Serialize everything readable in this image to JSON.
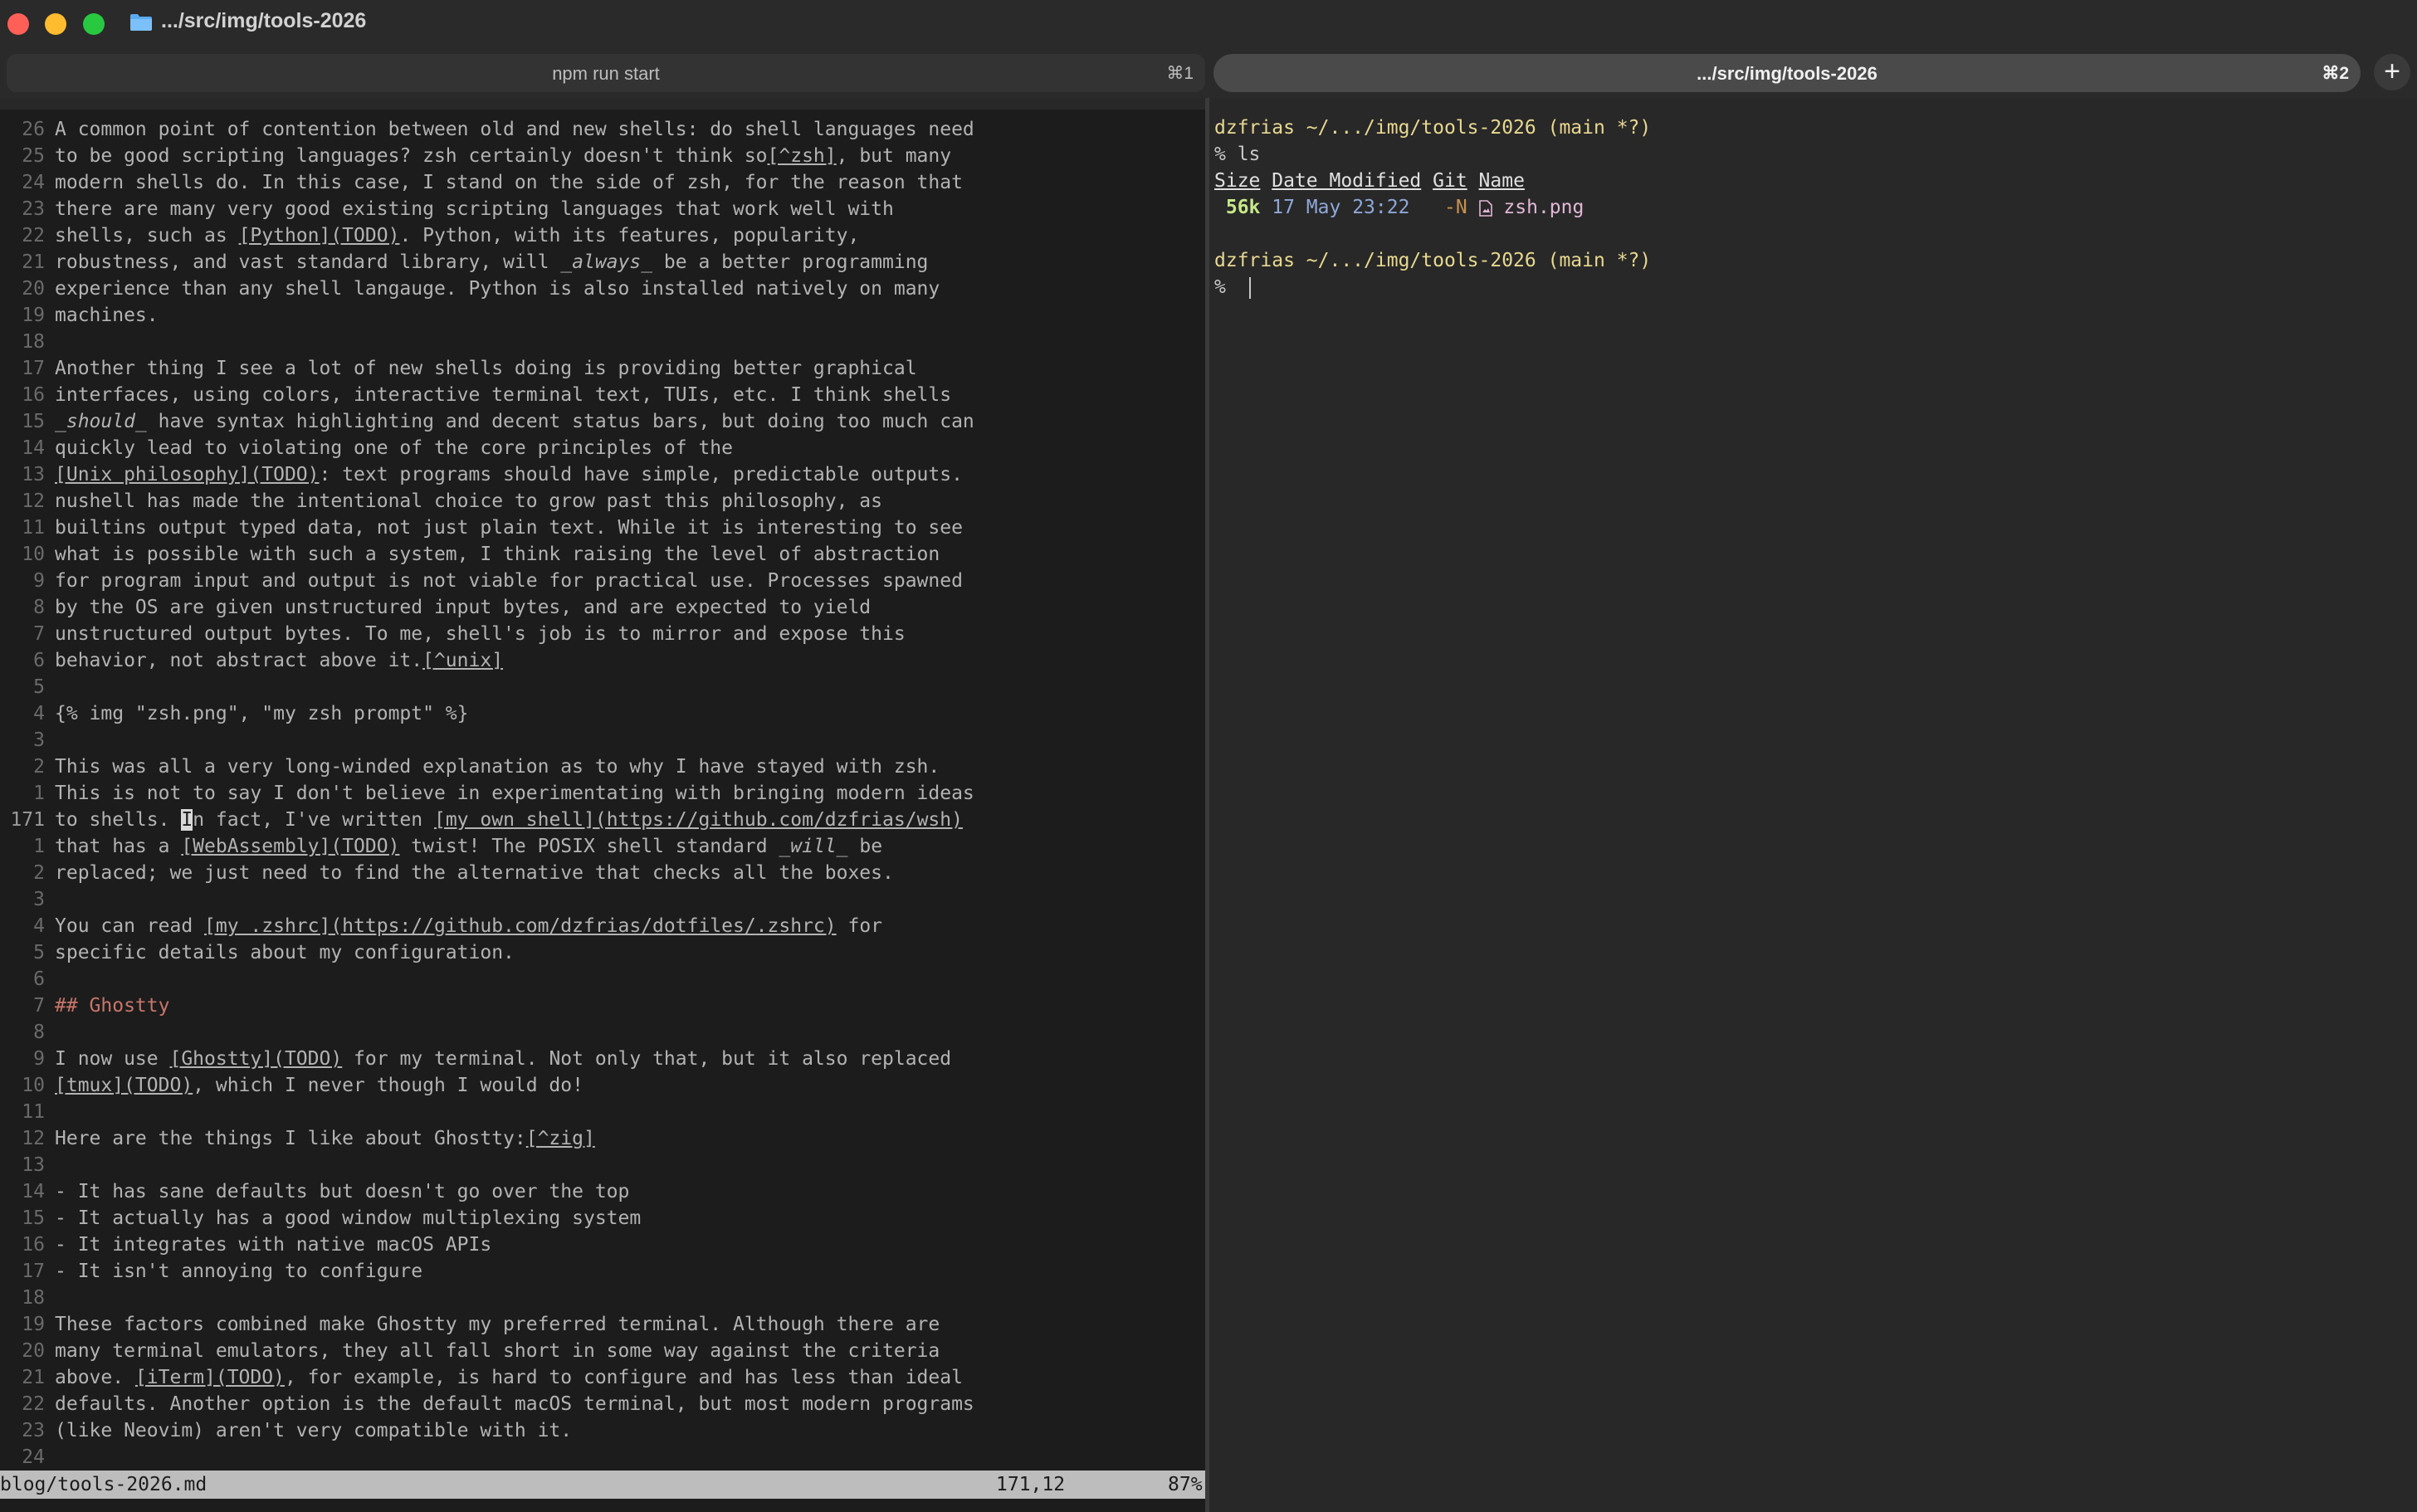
{
  "window": {
    "title": ".../src/img/tools-2026",
    "icon": "folder-icon"
  },
  "tabs": [
    {
      "label": "npm run start",
      "shortcut": "⌘1",
      "active": false
    },
    {
      "label": ".../src/img/tools-2026",
      "shortcut": "⌘2",
      "active": true
    }
  ],
  "new_tab_label": "+",
  "editor": {
    "lines": [
      {
        "n": "26",
        "parts": [
          {
            "t": "A common point of contention between old and new shells: do shell languages need"
          }
        ]
      },
      {
        "n": "25",
        "parts": [
          {
            "t": "to be good scripting languages? zsh certainly doesn't think so"
          },
          {
            "t": "[^zsh]",
            "s": "link"
          },
          {
            "t": ", but many"
          }
        ]
      },
      {
        "n": "24",
        "parts": [
          {
            "t": "modern shells do. In this case, I stand on the side of zsh, for the reason that"
          }
        ]
      },
      {
        "n": "23",
        "parts": [
          {
            "t": "there are many very good existing scripting languages that work well with"
          }
        ]
      },
      {
        "n": "22",
        "parts": [
          {
            "t": "shells, such as "
          },
          {
            "t": "[Python](TODO)",
            "s": "link"
          },
          {
            "t": ". Python, with its features, popularity,"
          }
        ]
      },
      {
        "n": "21",
        "parts": [
          {
            "t": "robustness, and vast standard library, will "
          },
          {
            "t": "_always_",
            "s": "ital"
          },
          {
            "t": " be a better programming"
          }
        ]
      },
      {
        "n": "20",
        "parts": [
          {
            "t": "experience than any shell langauge. Python is also installed natively on many"
          }
        ]
      },
      {
        "n": "19",
        "parts": [
          {
            "t": "machines."
          }
        ]
      },
      {
        "n": "18",
        "parts": [
          {
            "t": ""
          }
        ]
      },
      {
        "n": "17",
        "parts": [
          {
            "t": "Another thing I see a lot of new shells doing is providing better graphical"
          }
        ]
      },
      {
        "n": "16",
        "parts": [
          {
            "t": "interfaces, using colors, interactive terminal text, TUIs, etc. I think shells"
          }
        ]
      },
      {
        "n": "15",
        "parts": [
          {
            "t": "_should_",
            "s": "ital"
          },
          {
            "t": " have syntax highlighting and decent status bars, but doing too much can"
          }
        ]
      },
      {
        "n": "14",
        "parts": [
          {
            "t": "quickly lead to violating one of the core principles of the"
          }
        ]
      },
      {
        "n": "13",
        "parts": [
          {
            "t": "[Unix philosophy](TODO)",
            "s": "link"
          },
          {
            "t": ": text programs should have simple, predictable outputs."
          }
        ]
      },
      {
        "n": "12",
        "parts": [
          {
            "t": "nushell has made the intentional choice to grow past this philosophy, as"
          }
        ]
      },
      {
        "n": "11",
        "parts": [
          {
            "t": "builtins output typed data, not just plain text. While it is interesting to see"
          }
        ]
      },
      {
        "n": "10",
        "parts": [
          {
            "t": "what is possible with such a system, I think raising the level of abstraction"
          }
        ]
      },
      {
        "n": "9",
        "parts": [
          {
            "t": "for program input and output is not viable for practical use. Processes spawned"
          }
        ]
      },
      {
        "n": "8",
        "parts": [
          {
            "t": "by the OS are given unstructured input bytes, and are expected to yield"
          }
        ]
      },
      {
        "n": "7",
        "parts": [
          {
            "t": "unstructured output bytes. To me, shell's job is to mirror and expose this"
          }
        ]
      },
      {
        "n": "6",
        "parts": [
          {
            "t": "behavior, not abstract above it."
          },
          {
            "t": "[^unix]",
            "s": "link"
          }
        ]
      },
      {
        "n": "5",
        "parts": [
          {
            "t": ""
          }
        ]
      },
      {
        "n": "4",
        "parts": [
          {
            "t": "{% img \"zsh.png\", \"my zsh prompt\" %}"
          }
        ]
      },
      {
        "n": "3",
        "parts": [
          {
            "t": ""
          }
        ]
      },
      {
        "n": "2",
        "parts": [
          {
            "t": "This was all a very long-winded explanation as to why I have stayed with zsh."
          }
        ]
      },
      {
        "n": "1",
        "parts": [
          {
            "t": "This is not to say I don't believe in experimentating with bringing modern ideas"
          }
        ]
      },
      {
        "n": "171",
        "current": true,
        "parts": [
          {
            "t": "to shells. "
          },
          {
            "t": "I",
            "s": "cursor"
          },
          {
            "t": "n fact, I've written "
          },
          {
            "t": "[my own shell](https://github.com/dzfrias/wsh)",
            "s": "link"
          }
        ]
      },
      {
        "n": "1",
        "parts": [
          {
            "t": "that has a "
          },
          {
            "t": "[WebAssembly](TODO)",
            "s": "link"
          },
          {
            "t": " twist! The POSIX shell standard "
          },
          {
            "t": "_will_",
            "s": "ital"
          },
          {
            "t": " be"
          }
        ]
      },
      {
        "n": "2",
        "parts": [
          {
            "t": "replaced; we just need to find the alternative that checks all the boxes."
          }
        ]
      },
      {
        "n": "3",
        "parts": [
          {
            "t": ""
          }
        ]
      },
      {
        "n": "4",
        "parts": [
          {
            "t": "You can read "
          },
          {
            "t": "[my .zshrc](https://github.com/dzfrias/dotfiles/.zshrc)",
            "s": "link"
          },
          {
            "t": " for"
          }
        ]
      },
      {
        "n": "5",
        "parts": [
          {
            "t": "specific details about my configuration."
          }
        ]
      },
      {
        "n": "6",
        "parts": [
          {
            "t": ""
          }
        ]
      },
      {
        "n": "7",
        "parts": [
          {
            "t": "## Ghostty",
            "s": "heading"
          }
        ]
      },
      {
        "n": "8",
        "parts": [
          {
            "t": ""
          }
        ]
      },
      {
        "n": "9",
        "parts": [
          {
            "t": "I now use "
          },
          {
            "t": "[Ghostty](TODO)",
            "s": "link"
          },
          {
            "t": " for my terminal. Not only that, but it also replaced"
          }
        ]
      },
      {
        "n": "10",
        "parts": [
          {
            "t": "[tmux](TODO)",
            "s": "link"
          },
          {
            "t": ", which I never though I would do!"
          }
        ]
      },
      {
        "n": "11",
        "parts": [
          {
            "t": ""
          }
        ]
      },
      {
        "n": "12",
        "parts": [
          {
            "t": "Here are the things I like about Ghostty:"
          },
          {
            "t": "[^zig]",
            "s": "link"
          }
        ]
      },
      {
        "n": "13",
        "parts": [
          {
            "t": ""
          }
        ]
      },
      {
        "n": "14",
        "parts": [
          {
            "t": "- It has sane defaults but doesn't go over the top"
          }
        ]
      },
      {
        "n": "15",
        "parts": [
          {
            "t": "- It actually has a good window multiplexing system"
          }
        ]
      },
      {
        "n": "16",
        "parts": [
          {
            "t": "- It integrates with native macOS APIs"
          }
        ]
      },
      {
        "n": "17",
        "parts": [
          {
            "t": "- It isn't annoying to configure"
          }
        ]
      },
      {
        "n": "18",
        "parts": [
          {
            "t": ""
          }
        ]
      },
      {
        "n": "19",
        "parts": [
          {
            "t": "These factors combined make Ghostty my preferred terminal. Although there are"
          }
        ]
      },
      {
        "n": "20",
        "parts": [
          {
            "t": "many terminal emulators, they all fall short in some way against the criteria"
          }
        ]
      },
      {
        "n": "21",
        "parts": [
          {
            "t": "above. "
          },
          {
            "t": "[iTerm](TODO)",
            "s": "link"
          },
          {
            "t": ", for example, is hard to configure and has less than ideal"
          }
        ]
      },
      {
        "n": "22",
        "parts": [
          {
            "t": "defaults. Another option is the default macOS terminal, but most modern programs"
          }
        ]
      },
      {
        "n": "23",
        "parts": [
          {
            "t": "(like Neovim) aren't very compatible with it."
          }
        ]
      },
      {
        "n": "24",
        "parts": [
          {
            "t": ""
          }
        ]
      }
    ],
    "status": {
      "file": "blog/tools-2026.md",
      "position": "171,12",
      "percent": "87%"
    }
  },
  "terminal": {
    "prompt1": {
      "user": "dzfrias",
      "path": "~/.../img/tools-2026",
      "branch": "(main *?)"
    },
    "command1": "% ls",
    "ls_headers": {
      "size": "Size",
      "date": "Date Modified",
      "git": "Git",
      "name": "Name"
    },
    "ls_rows": [
      {
        "size": "56k",
        "date": "17 May 23:22",
        "git": "-N",
        "icon": "image-file-icon",
        "name": "zsh.png"
      }
    ],
    "prompt2": {
      "user": "dzfrias",
      "path": "~/.../img/tools-2026",
      "branch": "(main *?)"
    },
    "command2": "%"
  }
}
